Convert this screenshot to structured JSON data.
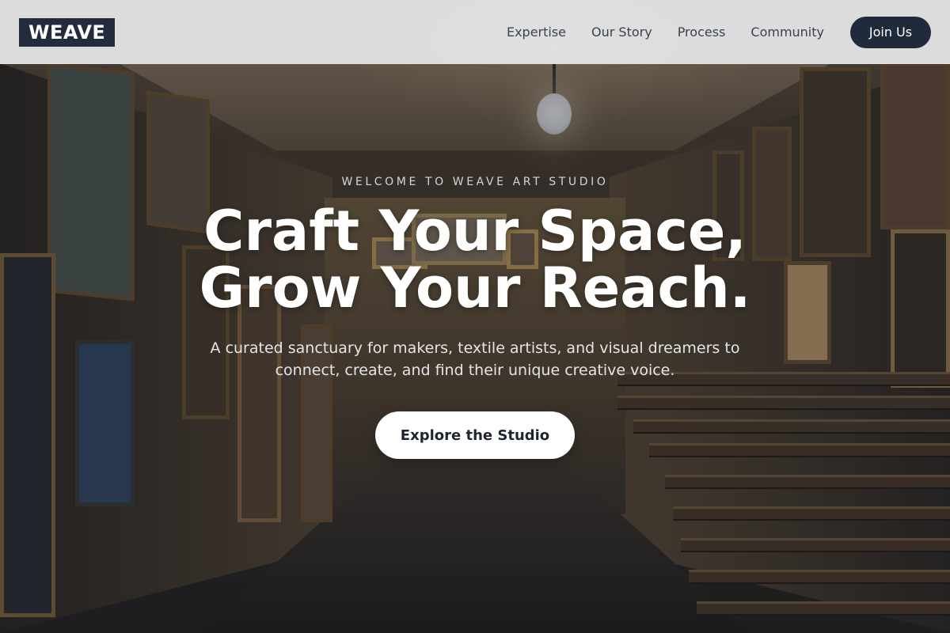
{
  "header": {
    "logo": "WEAVE",
    "nav": [
      {
        "label": "Expertise"
      },
      {
        "label": "Our Story"
      },
      {
        "label": "Process"
      },
      {
        "label": "Community"
      }
    ],
    "cta_label": "Join Us"
  },
  "hero": {
    "eyebrow": "WELCOME TO WEAVE ART STUDIO",
    "headline_line1": "Craft Your Space,",
    "headline_line2": "Grow Your Reach.",
    "subtext": "A curated sanctuary for makers, textile artists, and visual dreamers to connect, create, and find their unique creative voice.",
    "button_label": "Explore the Studio",
    "background_image": "art studio interior with stacked framed paintings"
  },
  "colors": {
    "navbar_bg": "#e7e8eb",
    "brand_dark": "#1f2a3b",
    "text_nav": "#3a4250",
    "hero_text": "#ffffff"
  }
}
